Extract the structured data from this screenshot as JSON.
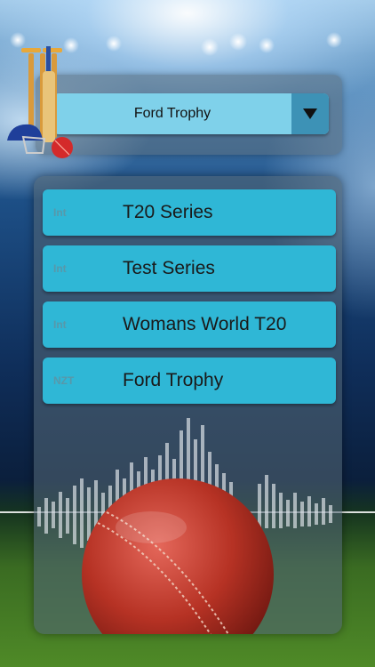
{
  "selector": {
    "selected": "Ford Trophy"
  },
  "icons": {
    "dropdown": "triangle-down-icon",
    "logo": "cricket-stumps-bat-helmet-ball-logo",
    "illustration": "cricket-ball-soundwave"
  },
  "competitions": [
    {
      "tag": "Int",
      "label": "T20 Series"
    },
    {
      "tag": "Int",
      "label": "Test Series"
    },
    {
      "tag": "Int",
      "label": "Womans World T20"
    },
    {
      "tag": "NZT",
      "label": "Ford Trophy"
    }
  ],
  "colors": {
    "item_bg": "#2fb7d6",
    "dropdown_bg": "#7fd1ea",
    "dropdown_button": "#3d92b6",
    "ball": "#c0392b"
  }
}
